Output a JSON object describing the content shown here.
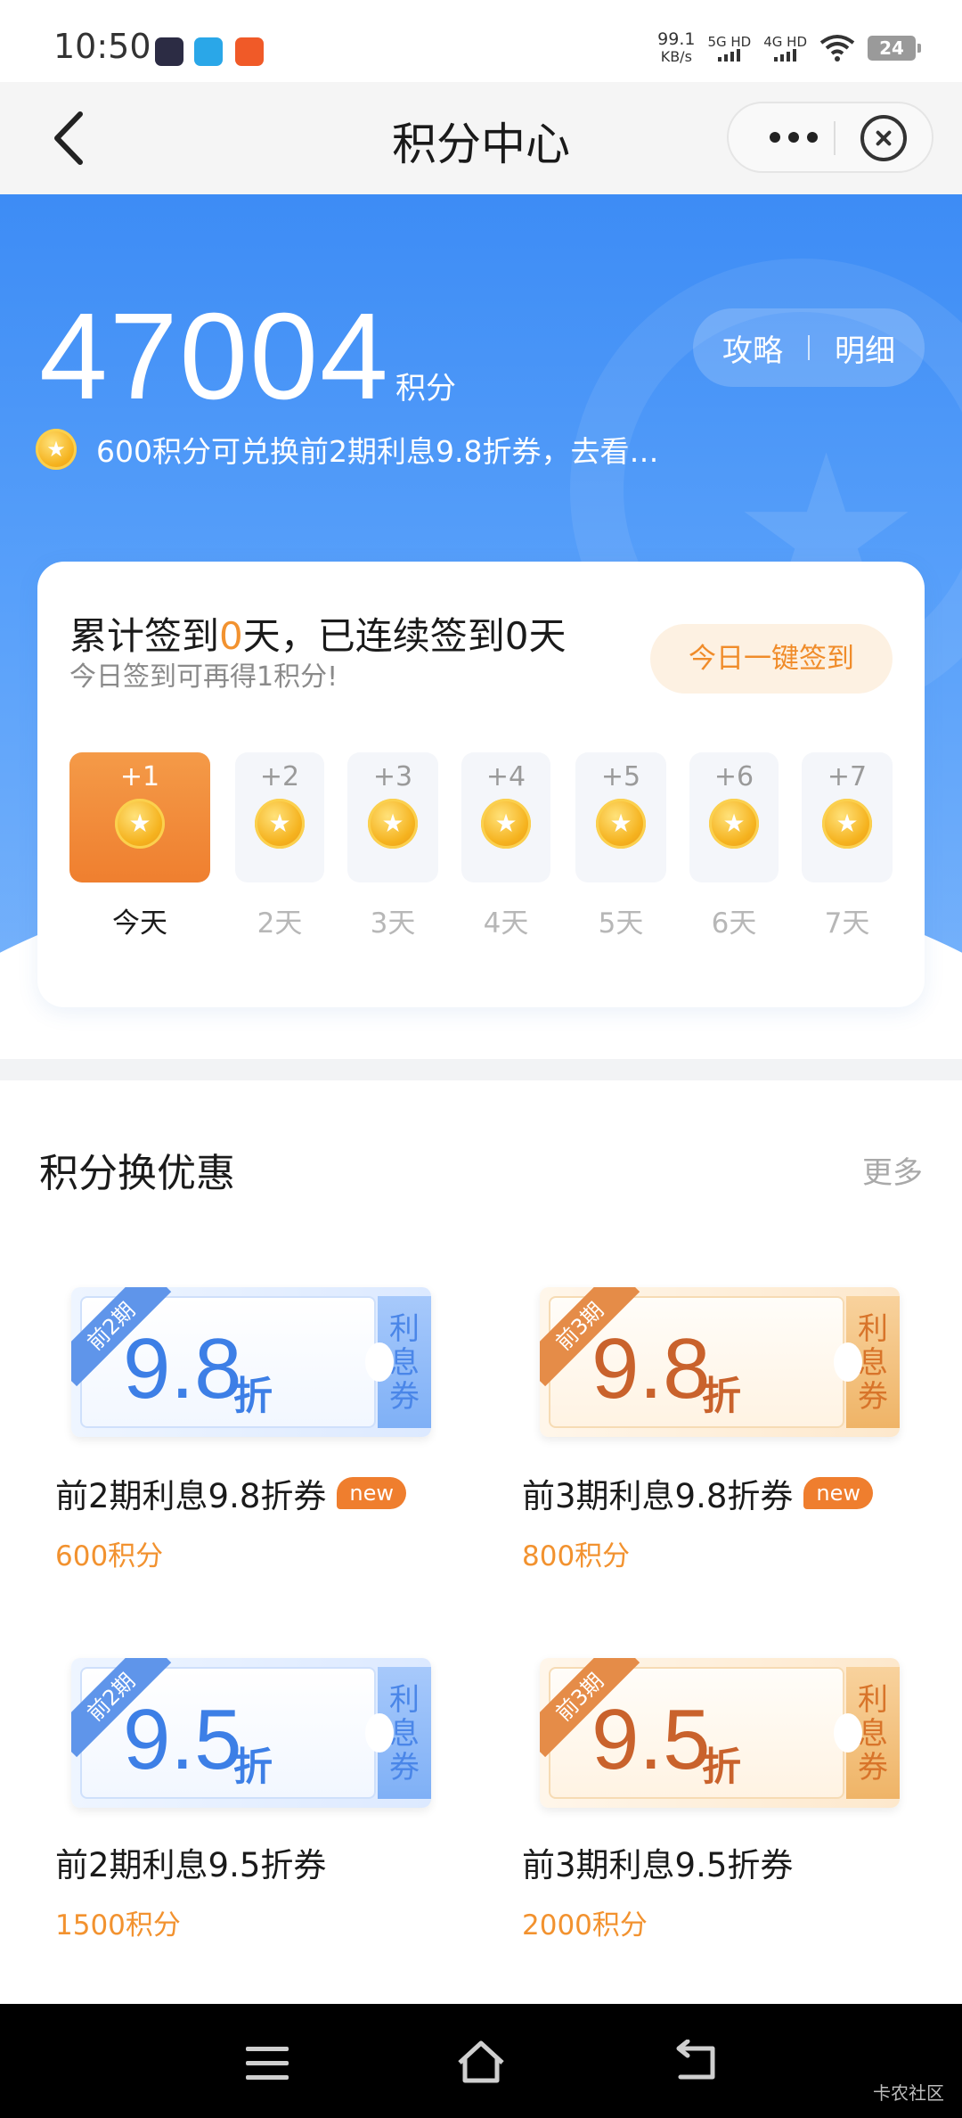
{
  "status_bar": {
    "time": "10:50",
    "speed_value": "99.1",
    "speed_unit": "KB/s",
    "net1": "5G HD",
    "net2": "4G HD",
    "battery": "24"
  },
  "nav": {
    "title": "积分中心",
    "back_icon": "back-arrow-icon",
    "more_icon": "more-dots-icon",
    "close_icon": "close-circle-icon"
  },
  "hero": {
    "points": "47004",
    "points_unit": "积分",
    "guide_label": "攻略",
    "detail_label": "明细",
    "promo_text": "600积分可兑换前2期利息9.8折券，去看…",
    "colors": {
      "primary": "#3d8cf5",
      "accent": "#f2922f"
    }
  },
  "checkin": {
    "title_prefix": "累计签到",
    "total_days": "0",
    "title_suffix": "天，已连续签到0天",
    "subtitle": "今日签到可再得1积分!",
    "button": "今日一键签到",
    "days": [
      {
        "plus": "+1",
        "label": "今天"
      },
      {
        "plus": "+2",
        "label": "2天"
      },
      {
        "plus": "+3",
        "label": "3天"
      },
      {
        "plus": "+4",
        "label": "4天"
      },
      {
        "plus": "+5",
        "label": "5天"
      },
      {
        "plus": "+6",
        "label": "6天"
      },
      {
        "plus": "+7",
        "label": "7天"
      }
    ]
  },
  "exchange": {
    "title": "积分换优惠",
    "more": "更多",
    "coupons": [
      {
        "ribbon": "前2期",
        "value": "9.8",
        "unit": "折",
        "side": "利息券",
        "name": "前2期利息9.8折券",
        "badge": "new",
        "points": "600积分",
        "theme": "blue"
      },
      {
        "ribbon": "前3期",
        "value": "9.8",
        "unit": "折",
        "side": "利息券",
        "name": "前3期利息9.8折券",
        "badge": "new",
        "points": "800积分",
        "theme": "orange"
      },
      {
        "ribbon": "前2期",
        "value": "9.5",
        "unit": "折",
        "side": "利息券",
        "name": "前2期利息9.5折券",
        "badge": "",
        "points": "1500积分",
        "theme": "blue"
      },
      {
        "ribbon": "前3期",
        "value": "9.5",
        "unit": "折",
        "side": "利息券",
        "name": "前3期利息9.5折券",
        "badge": "",
        "points": "2000积分",
        "theme": "orange"
      }
    ]
  },
  "system_nav": {
    "menu_icon": "menu-icon",
    "home_icon": "home-icon",
    "back_icon": "back-icon"
  },
  "watermark": "卡农社区"
}
